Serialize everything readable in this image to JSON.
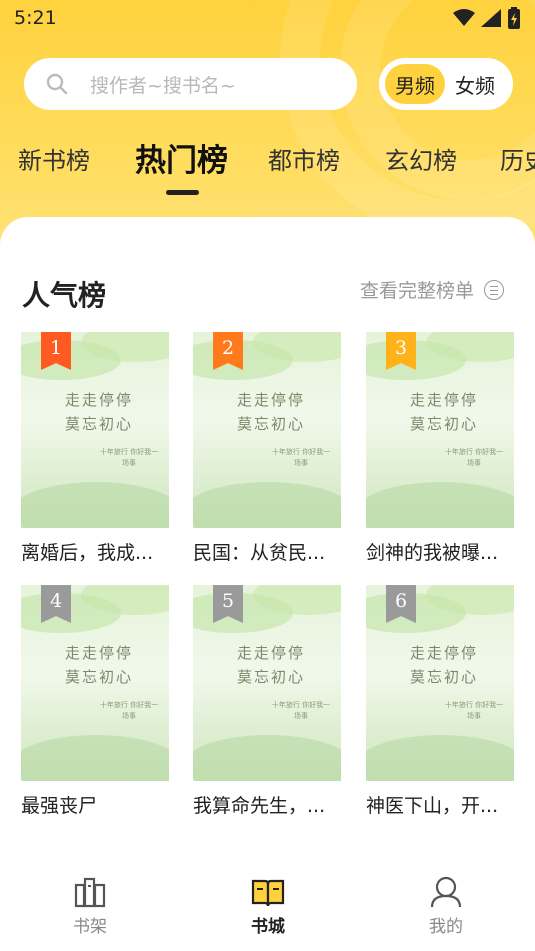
{
  "status_bar": {
    "time": "5:21"
  },
  "search": {
    "placeholder": "搜作者~搜书名~"
  },
  "gender_toggle": {
    "male": "男频",
    "female": "女频",
    "selected": "男频"
  },
  "tabs": [
    {
      "label": "新书榜"
    },
    {
      "label": "热门榜",
      "active": true
    },
    {
      "label": "都市榜"
    },
    {
      "label": "玄幻榜"
    },
    {
      "label": "历史"
    }
  ],
  "section": {
    "title": "人气榜",
    "view_all": "查看完整榜单"
  },
  "cover": {
    "title_line1": "走走停停",
    "title_line2": "莫忘初心",
    "subtitle": "十年旅行 你好我一场事"
  },
  "books": [
    {
      "rank": "1",
      "title": "离婚后，我成..."
    },
    {
      "rank": "2",
      "title": "民国：从贫民..."
    },
    {
      "rank": "3",
      "title": "剑神的我被曝..."
    },
    {
      "rank": "4",
      "title": "最强丧尸"
    },
    {
      "rank": "5",
      "title": "我算命先生，..."
    },
    {
      "rank": "6",
      "title": "神医下山，开..."
    }
  ],
  "bottom_nav": [
    {
      "label": "书架",
      "icon": "bookshelf-icon"
    },
    {
      "label": "书城",
      "icon": "open-book-icon",
      "active": true
    },
    {
      "label": "我的",
      "icon": "user-icon"
    }
  ],
  "colors": {
    "accent": "#ffd23d",
    "rank1": "#ff5a1f",
    "rank2": "#ff7a1a",
    "rank3": "#ffb21a",
    "rank_other": "#9a9a9a"
  }
}
